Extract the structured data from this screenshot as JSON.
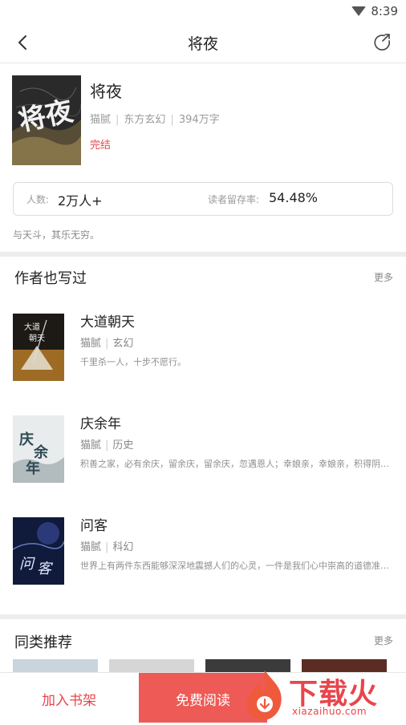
{
  "status_bar": {
    "time": "8:39",
    "icons": [
      "wifi-icon"
    ]
  },
  "nav": {
    "title": "将夜",
    "icons": [
      "back-arrow-icon",
      "share-icon"
    ]
  },
  "book": {
    "title": "将夜",
    "author": "猫腻",
    "category": "东方玄幻",
    "word_count": "394万字",
    "status": "完结",
    "cover_text": "将夜",
    "stats": {
      "readers_label": "人数:",
      "readers_value": "2万人+",
      "retention_label": "读者留存率:",
      "retention_value": "54.48%"
    },
    "tagline": "与天斗，其乐无穷。"
  },
  "author_section": {
    "title": "作者也写过",
    "more": "更多",
    "books": [
      {
        "title": "大道朝天",
        "author": "猫腻",
        "category": "玄幻",
        "desc": "千里杀一人，十步不愿行。"
      },
      {
        "title": "庆余年",
        "author": "猫腻",
        "category": "历史",
        "desc": "积善之家，必有余庆，留余庆，留余庆，忽遇恩人；幸娘亲，幸娘亲，积得阴功。"
      },
      {
        "title": "问客",
        "author": "猫腻",
        "category": "科幻",
        "desc": "世界上有两件东西能够深深地震撼人们的心灵，一件是我们心中崇高的道德准则，另一件是我们头顶灿烂的星空。"
      }
    ]
  },
  "similar_section": {
    "title": "同类推荐",
    "more": "更多"
  },
  "bottom_bar": {
    "add_shelf": "加入书架",
    "free_read": "免费阅读"
  },
  "watermark": {
    "text": "下载火",
    "url": "xiazaihuo.com"
  },
  "colors": {
    "accent": "#e8454b",
    "read_button": "#ee5a55",
    "divider": "#ededed"
  }
}
